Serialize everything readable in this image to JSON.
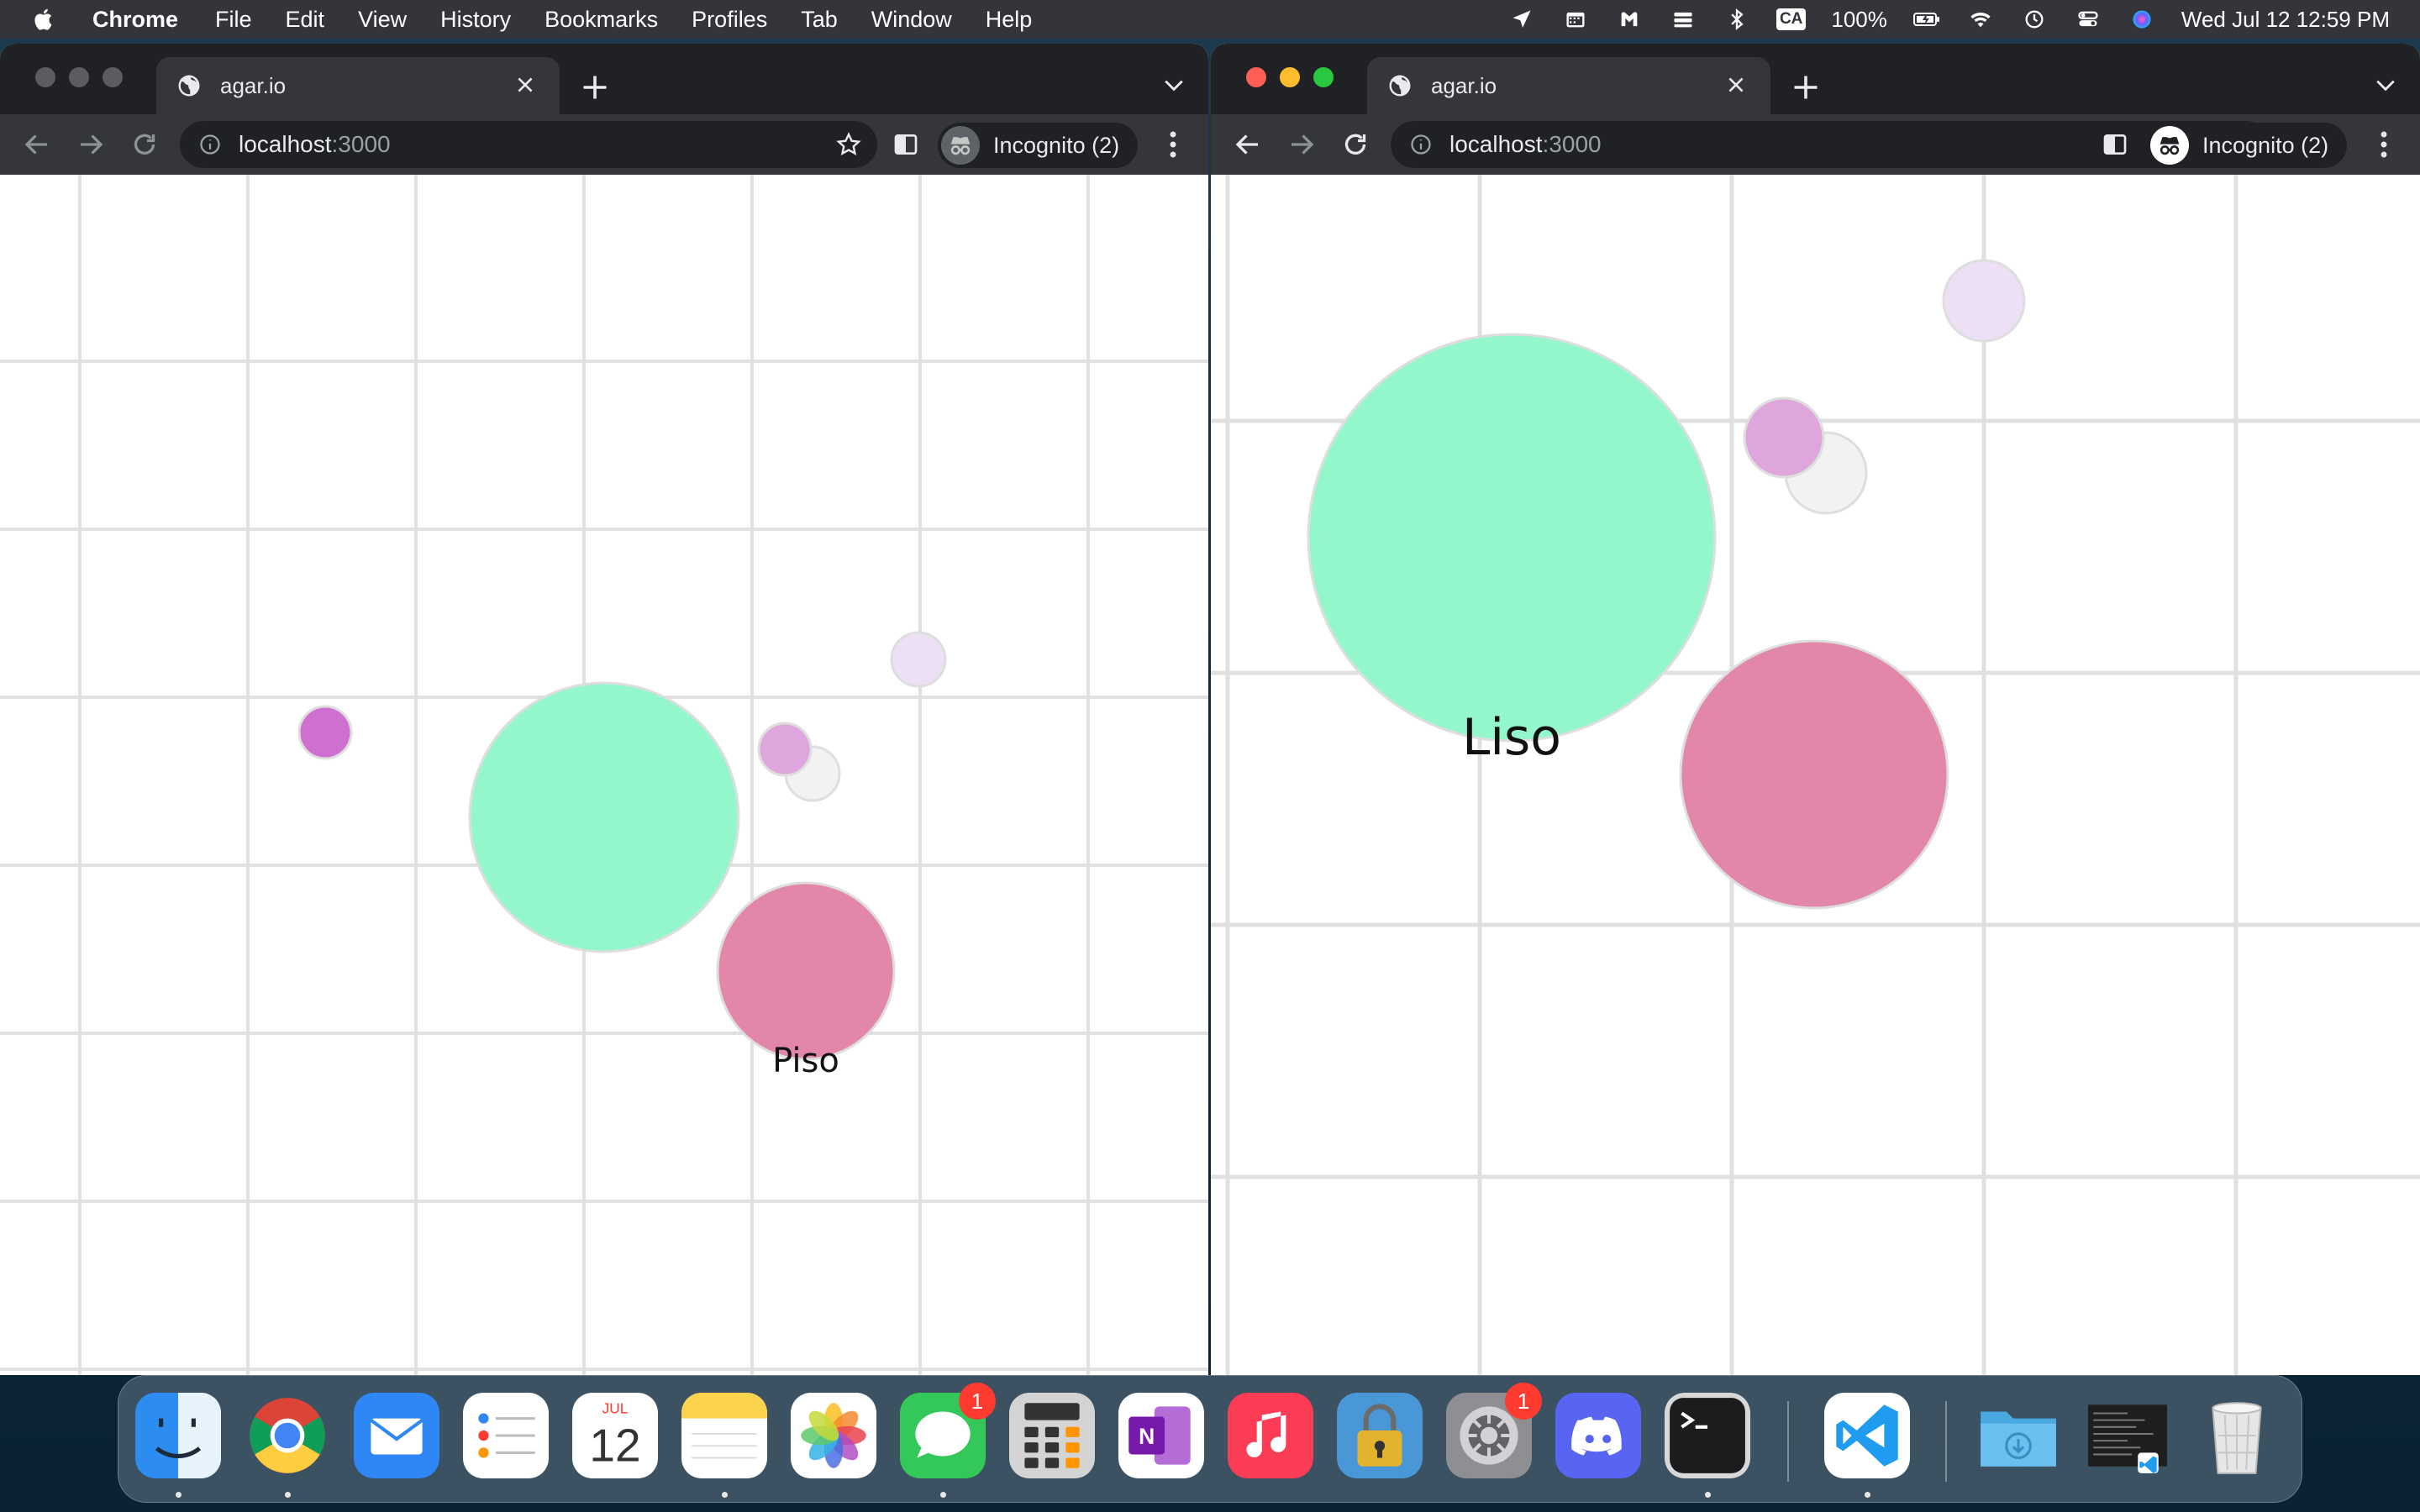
{
  "menubar": {
    "app_name": "Chrome",
    "items": [
      "File",
      "Edit",
      "View",
      "History",
      "Bookmarks",
      "Profiles",
      "Tab",
      "Window",
      "Help"
    ],
    "status": {
      "input_source": "CA",
      "battery": "100%",
      "datetime": "Wed Jul 12  12:59 PM"
    }
  },
  "windows": [
    {
      "tab_title": "agar.io",
      "url_host": "localhost",
      "url_port": ":3000",
      "incognito_label": "Incognito (2)",
      "player_label": "Piso"
    },
    {
      "tab_title": "agar.io",
      "url_host": "localhost",
      "url_port": ":3000",
      "incognito_label": "Incognito (2)",
      "player_label": "Liso"
    }
  ],
  "game_colors": {
    "grid": "#e0e0e0",
    "player_green": "#93f7cb",
    "player_pink": "#e387aa",
    "food_magenta": "#cf6fcf",
    "food_orchid": "#dea6dc",
    "food_lavender": "#ede0f5",
    "food_white": "#f2f2f2",
    "cell_border": "#dedede"
  },
  "dock": {
    "apps": [
      {
        "name": "Finder",
        "icon": "finder-icon"
      },
      {
        "name": "Google Chrome",
        "icon": "chrome-icon"
      },
      {
        "name": "Mail",
        "icon": "mail-icon"
      },
      {
        "name": "Reminders",
        "icon": "reminders-icon"
      },
      {
        "name": "Calendar",
        "icon": "calendar-icon",
        "month": "JUL",
        "day": "12"
      },
      {
        "name": "Notes",
        "icon": "notes-icon"
      },
      {
        "name": "Photos",
        "icon": "photos-icon"
      },
      {
        "name": "Messages",
        "icon": "messages-icon",
        "badge": "1"
      },
      {
        "name": "Calculator",
        "icon": "calculator-icon"
      },
      {
        "name": "OneNote",
        "icon": "onenote-icon"
      },
      {
        "name": "Music",
        "icon": "music-icon"
      },
      {
        "name": "Keychain Access",
        "icon": "keychain-icon"
      },
      {
        "name": "System Settings",
        "icon": "settings-icon",
        "badge": "1"
      },
      {
        "name": "Discord",
        "icon": "discord-icon"
      },
      {
        "name": "Terminal",
        "icon": "terminal-icon"
      },
      {
        "name": "Visual Studio Code",
        "icon": "vscode-icon"
      },
      {
        "name": "Downloads",
        "icon": "downloads-folder-icon"
      },
      {
        "name": "Recent window",
        "icon": "window-thumbnail-icon"
      },
      {
        "name": "Trash",
        "icon": "trash-icon"
      }
    ]
  }
}
